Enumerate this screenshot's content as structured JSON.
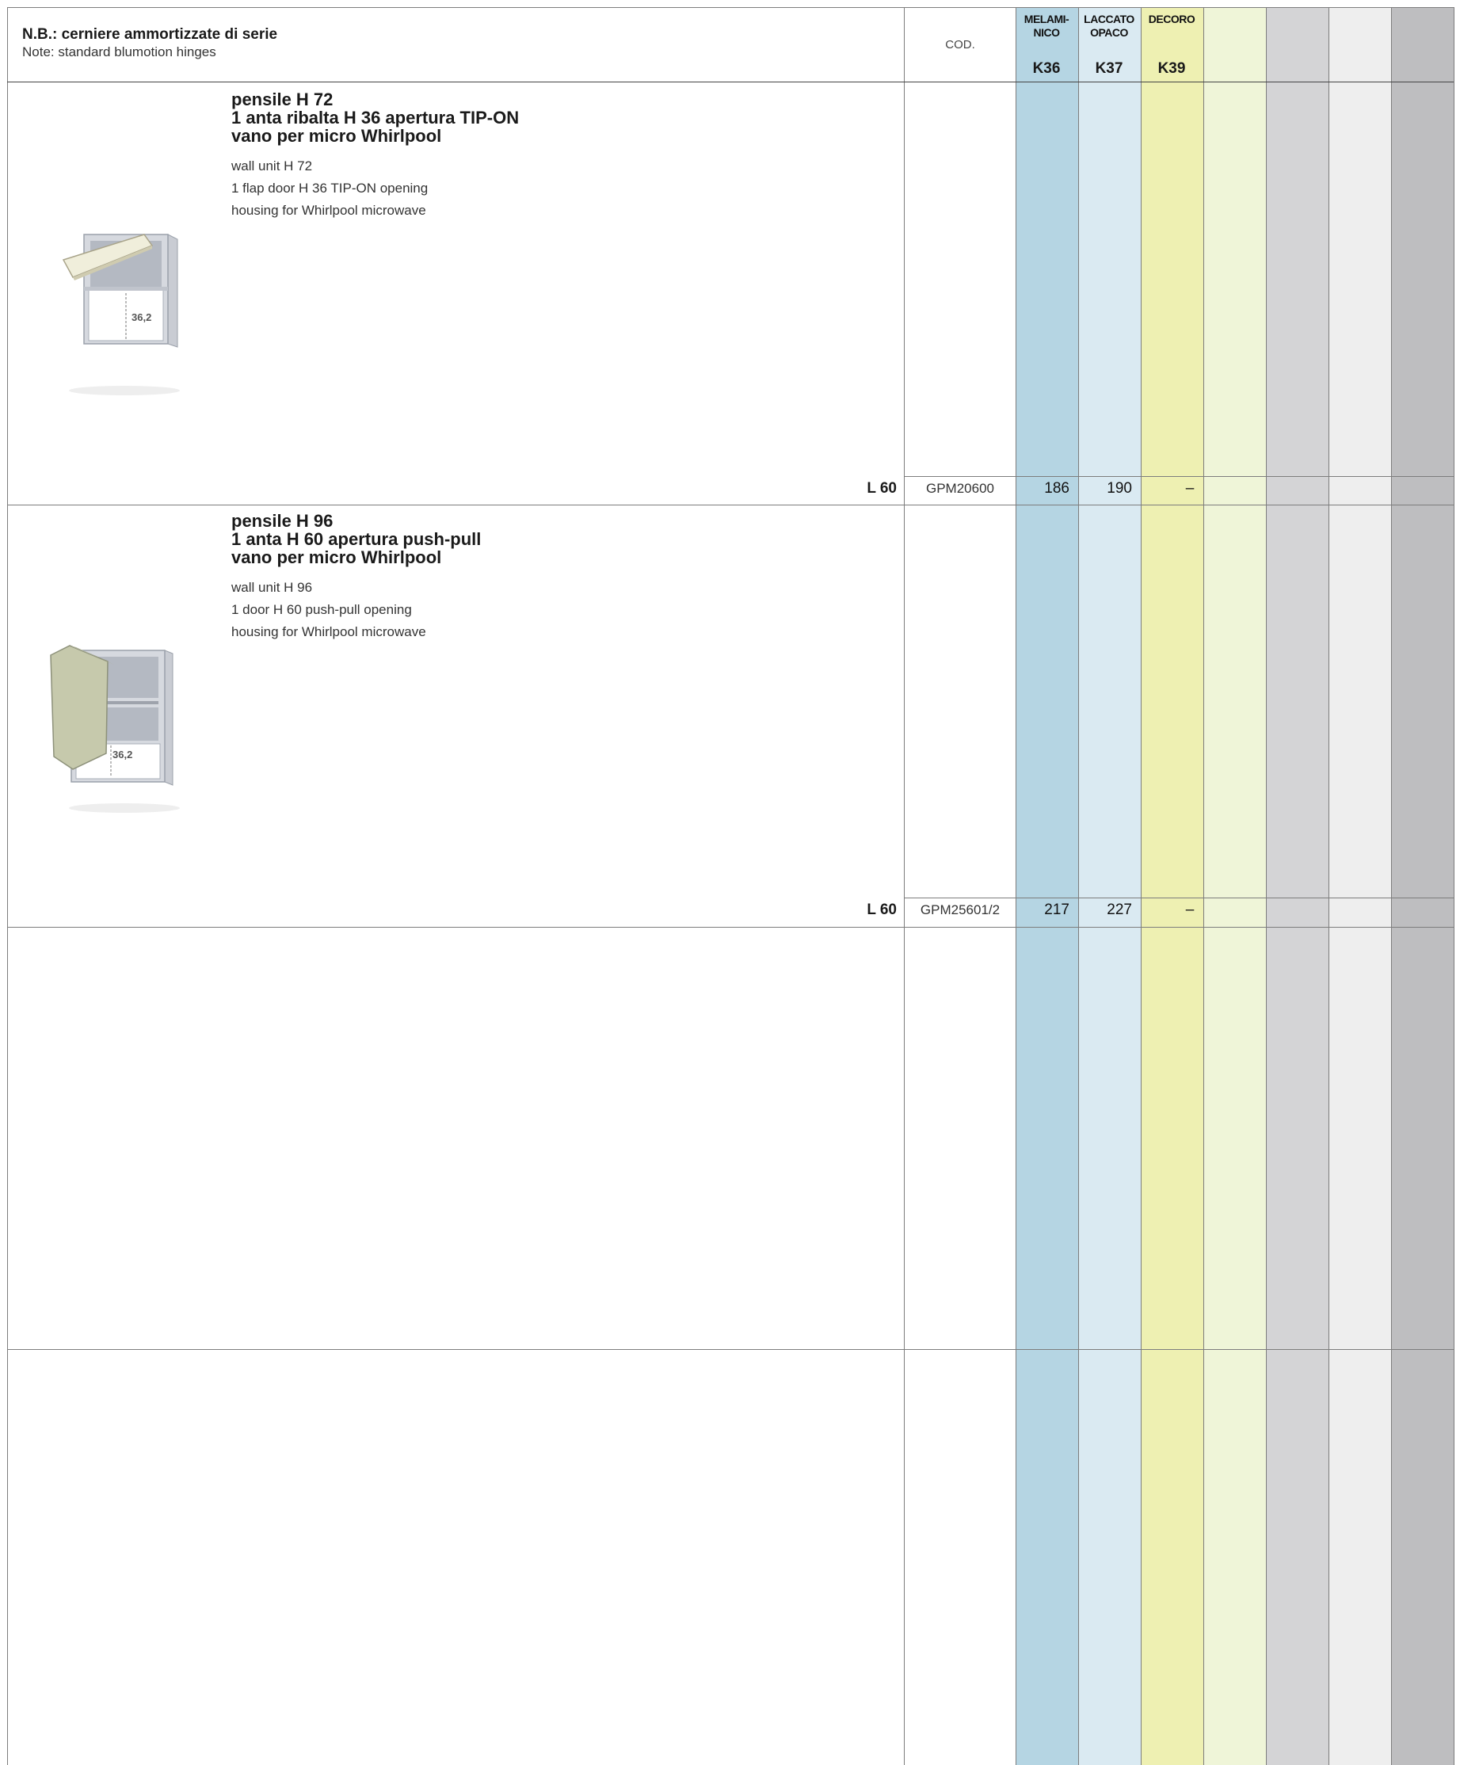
{
  "header": {
    "note_title": "N.B.: cerniere ammortizzate di serie",
    "note_subtitle": "Note: standard blumotion hinges",
    "cod_label": "COD.",
    "columns": [
      {
        "label_line1": "MELAMI-",
        "label_line2": "NICO",
        "code": "K36"
      },
      {
        "label_line1": "LACCATO",
        "label_line2": "OPACO",
        "code": "K37"
      },
      {
        "label_line1": "DECORO",
        "label_line2": "",
        "code": "K39"
      }
    ]
  },
  "colors": {
    "melaminico": "#b5d5e3",
    "laccato": "#daeaf2",
    "decoro": "#eef0b2",
    "col4": "#eff5d8",
    "col5": "#d4d4d6",
    "col6": "#eeeeee",
    "col7": "#bebec0"
  },
  "products": [
    {
      "title_lines": [
        "pensile H 72",
        "1 anta ribalta H 36 apertura TIP-ON",
        "vano per micro Whirlpool"
      ],
      "desc_lines": [
        "wall unit H 72",
        "1 flap door H 36 TIP-ON opening",
        "housing for Whirlpool microwave"
      ],
      "dimension": "36,2",
      "image_icon": "wall-unit-flap-door-icon",
      "width": "L 60",
      "code": "GPM20600",
      "price_k36": "186",
      "price_k37": "190",
      "price_k39": "–"
    },
    {
      "title_lines": [
        "pensile H 96",
        "1 anta H 60  apertura push-pull",
        "vano per micro Whirlpool"
      ],
      "desc_lines": [
        "wall unit H 96",
        "1 door H 60 push-pull opening",
        "housing for Whirlpool microwave"
      ],
      "dimension": "36,2",
      "image_icon": "wall-unit-side-door-icon",
      "width": "L 60",
      "code": "GPM25601/2",
      "price_k36": "217",
      "price_k37": "227",
      "price_k39": "–"
    }
  ]
}
